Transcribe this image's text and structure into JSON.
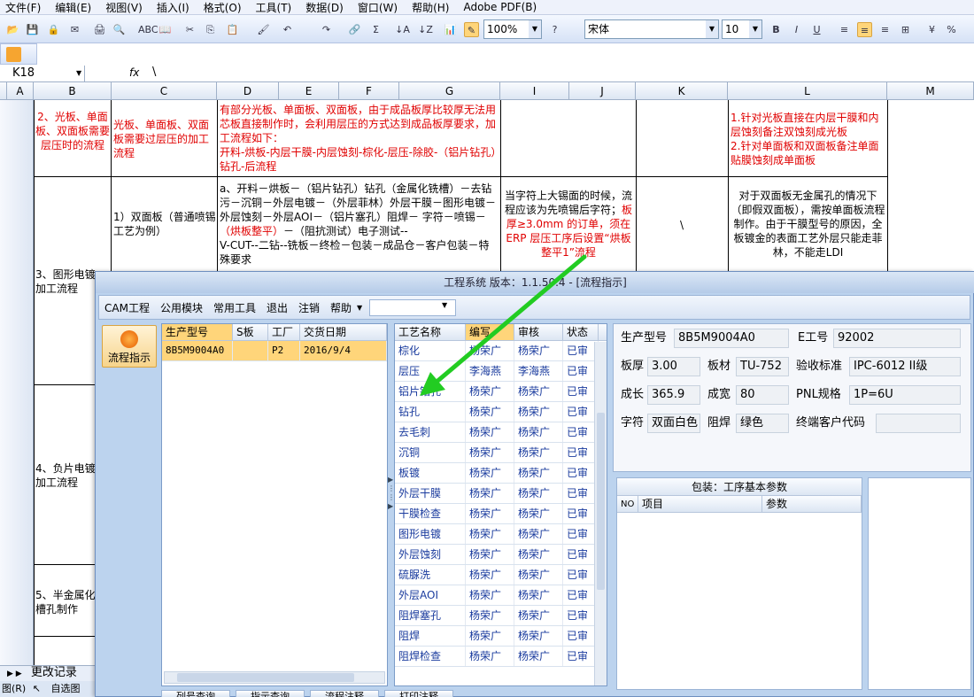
{
  "excel": {
    "menu": [
      "文件(F)",
      "编辑(E)",
      "视图(V)",
      "插入(I)",
      "格式(O)",
      "工具(T)",
      "数据(D)",
      "窗口(W)",
      "帮助(H)",
      "Adobe PDF(B)"
    ],
    "zoom": "100%",
    "font_name": "宋体",
    "font_size": "10",
    "fx_label": "fx",
    "cell_ref": "K18",
    "formula": "\\",
    "columns": [
      "A",
      "B",
      "C",
      "D",
      "E",
      "F",
      "G",
      "I",
      "J",
      "K",
      "L",
      "M"
    ],
    "rows": {
      "r1": {
        "b": "2、光板、单面板、双面板需要层压时的流程",
        "c": "光板、单面板、双面板需要过层压的加工流程",
        "d": "有部分光板、单面板、双面板，由于成品板厚比较厚无法用芯板直接制作时，会利用层压的方式达到成品板厚要求，加工流程如下：\n开料-烘板-内层干膜-内层蚀刻-棕化-层压-除胶-（铝片钻孔）钻孔-后流程",
        "l": "1.针对光板直接在内层干膜和内层蚀刻备注双蚀刻成光板\n2.针对单面板和双面板备注单面贴膜蚀刻成单面板"
      },
      "r2": {
        "c": "1）双面板（普通喷锡工艺为例）",
        "d_a": "a、开料－烘板－（铝片钻孔）钻孔（金属化铣槽）－去钻污－沉铜－外层电镀－（外层菲林）外层干膜－图形电镀－外层蚀刻－外层AOI－（铝片塞孔）阻焊－ 字符－喷锡－",
        "d_red": "（烘板整平）",
        "d_b": "－（阻抗测试）电子测试--\nV-CUT--二钻--铣板－终检－包装－成品仓－客户包装－特殊要求",
        "i_a": "当字符上大锡面的时候，流程应该为先喷锡后字符；",
        "i_red": "板厚≥3.0mm 的订单，须在ERP 层压工序后设置“烘板整平1”流程",
        "k": "\\",
        "l": "对于双面板无金属孔的情况下（即假双面板），需按单面板流程制作。由于干膜型号的原因，全板镀金的表面工艺外层只能走菲林，不能走LDI"
      },
      "b3": "3、图形电镀\n加工流程",
      "b4": "4、负片电镀\n加工流程",
      "b5": "5、半金属化\n槽孔制作"
    },
    "sheet_tab": "更改记录",
    "status_left": "图(R)",
    "status_draw": "自选图"
  },
  "dialog": {
    "title": "工程系统   版本：1.1.50.4 - [流程指示]",
    "menu": [
      "CAM工程",
      "公用模块",
      "常用工具",
      "退出",
      "注销",
      "帮助"
    ],
    "side_button": "流程指示",
    "left_grid": {
      "headers": [
        "生产型号",
        "S板",
        "工厂",
        "交货日期"
      ],
      "rows": [
        [
          "8B5M9004A0",
          "",
          "P2",
          "2016/9/4"
        ]
      ]
    },
    "process_grid": {
      "headers": [
        "工艺名称",
        "编写",
        "审核",
        "状态"
      ],
      "rows": [
        [
          "棕化",
          "杨荣广",
          "杨荣广",
          "已审"
        ],
        [
          "层压",
          "李海燕",
          "李海燕",
          "已审"
        ],
        [
          "铝片钻孔",
          "杨荣广",
          "杨荣广",
          "已审"
        ],
        [
          "钻孔",
          "杨荣广",
          "杨荣广",
          "已审"
        ],
        [
          "去毛刺",
          "杨荣广",
          "杨荣广",
          "已审"
        ],
        [
          "沉铜",
          "杨荣广",
          "杨荣广",
          "已审"
        ],
        [
          "板镀",
          "杨荣广",
          "杨荣广",
          "已审"
        ],
        [
          "外层干膜",
          "杨荣广",
          "杨荣广",
          "已审"
        ],
        [
          "干膜检查",
          "杨荣广",
          "杨荣广",
          "已审"
        ],
        [
          "图形电镀",
          "杨荣广",
          "杨荣广",
          "已审"
        ],
        [
          "外层蚀刻",
          "杨荣广",
          "杨荣广",
          "已审"
        ],
        [
          "硫脲洗",
          "杨荣广",
          "杨荣广",
          "已审"
        ],
        [
          "外层AOI",
          "杨荣广",
          "杨荣广",
          "已审"
        ],
        [
          "阻焊塞孔",
          "杨荣广",
          "杨荣广",
          "已审"
        ],
        [
          "阻焊",
          "杨荣广",
          "杨荣广",
          "已审"
        ],
        [
          "阻焊检查",
          "杨荣广",
          "杨荣广",
          "已审"
        ]
      ]
    },
    "info": {
      "model_label": "生产型号",
      "model": "8B5M9004A0",
      "eno_label": "E工号",
      "eno": "92002",
      "thick_label": "板厚",
      "thick": "3.00",
      "material_label": "板材",
      "material": "TU-752",
      "std_label": "验收标准",
      "std": "IPC-6012 II级",
      "len_label": "成长",
      "len": "365.9",
      "wid_label": "成宽",
      "wid": "80",
      "pnl_label": "PNL规格",
      "pnl": "1P=6U",
      "char_label": "字符",
      "char": "双面白色",
      "mask_label": "阻焊",
      "mask": "绿色",
      "cust_label": "终端客户代码",
      "cust": ""
    },
    "params": {
      "title": "包装：工序基本参数",
      "headers": [
        "NO",
        "项目",
        "参数"
      ]
    },
    "bottom_buttons": [
      "列号查询",
      "指示查询",
      "流程注释",
      "打印注释"
    ]
  },
  "colors": {
    "red_text": "#e00000",
    "arrow": "#22cc22",
    "selected_row": "#ffd57a",
    "blue_text": "#1a3b9e"
  }
}
